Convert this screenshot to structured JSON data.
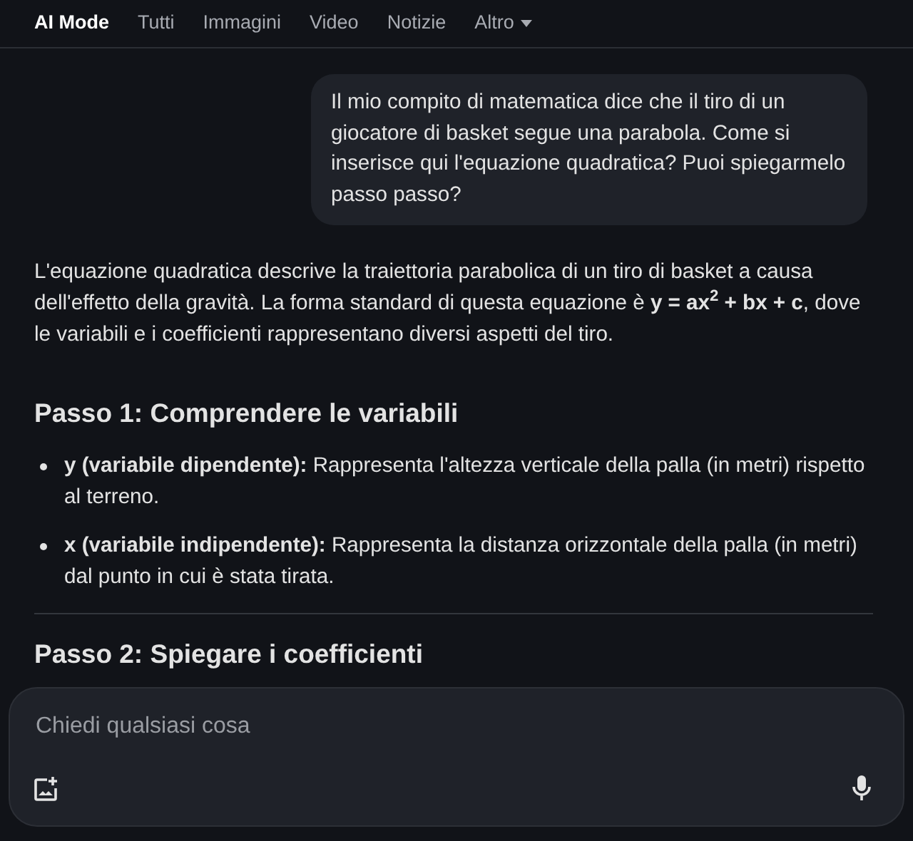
{
  "tabs": [
    {
      "label": "AI Mode",
      "selected": true
    },
    {
      "label": "Tutti",
      "selected": false
    },
    {
      "label": "Immagini",
      "selected": false
    },
    {
      "label": "Video",
      "selected": false
    },
    {
      "label": "Notizie",
      "selected": false
    },
    {
      "label": "Altro",
      "selected": false,
      "dropdown": true
    }
  ],
  "user_message": "Il mio compito di matematica dice che il tiro di un giocatore di basket segue una parabola. Come si inserisce qui l'equazione quadratica? Puoi spiegarmelo passo passo?",
  "answer": {
    "intro": "L'equazione quadratica descrive la traiettoria parabolica di un tiro di basket a causa dell'effetto della gravità. La forma standard di questa equazione è **y = ax$^{2}$ + bx + c**, dove le variabili e i coefficienti rappresentano diversi aspetti del tiro.",
    "sections": [
      {
        "heading": "Passo 1: Comprendere le variabili",
        "bullets": [
          "**y (variabile dipendente):** Rappresenta l'altezza verticale della palla (in metri) rispetto al terreno.",
          "**x (variabile indipendente):** Rappresenta la distanza orizzontale della palla (in metri) dal punto in cui è stata tirata."
        ]
      },
      {
        "heading": "Passo 2: Spiegare i coefficienti"
      }
    ]
  },
  "composer": {
    "placeholder": "Chiedi qualsiasi cosa"
  }
}
